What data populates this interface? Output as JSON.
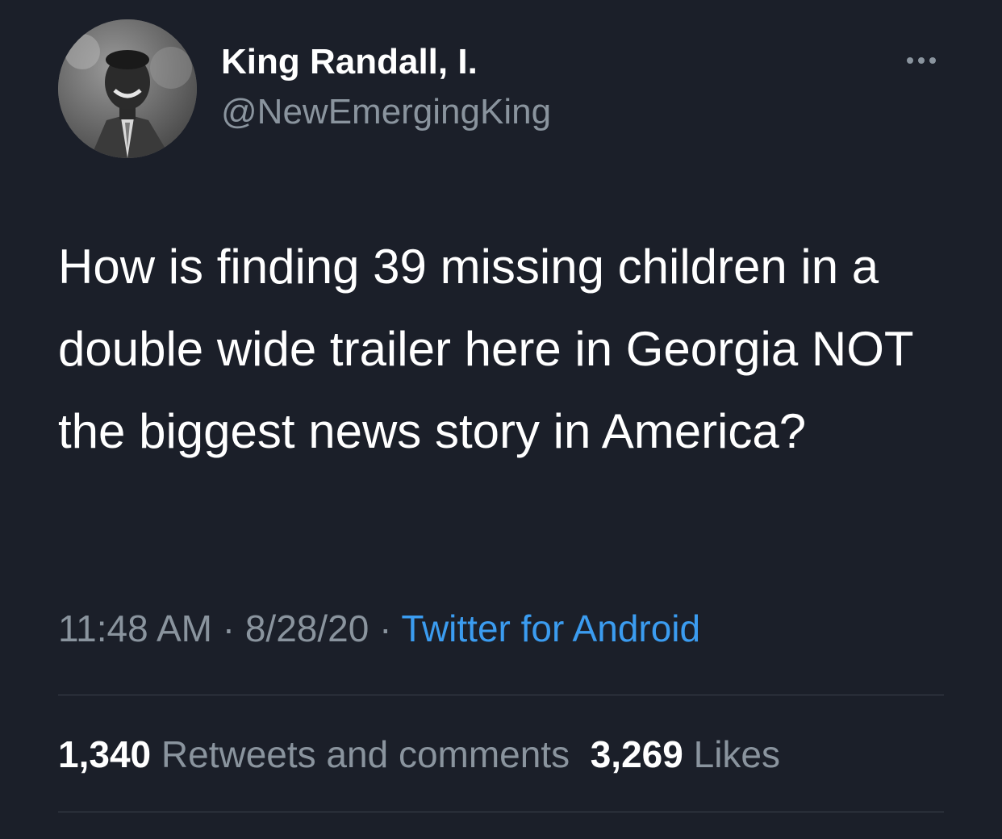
{
  "tweet": {
    "display_name": "King Randall, I.",
    "handle": "@NewEmergingKing",
    "text": "How is finding 39 missing children in a double wide trailer here in Georgia NOT the biggest news story in America?",
    "time": "11:48 AM",
    "separator": "·",
    "date": "8/28/20",
    "source": "Twitter for Android",
    "retweets_count": "1,340",
    "retweets_label": "Retweets and comments",
    "likes_count": "3,269",
    "likes_label": "Likes"
  },
  "icons": {
    "more": "more-horizontal-icon",
    "avatar": "profile-photo"
  },
  "colors": {
    "background": "#1b1f29",
    "secondary_text": "#8a949e",
    "link": "#3b9cf0"
  }
}
